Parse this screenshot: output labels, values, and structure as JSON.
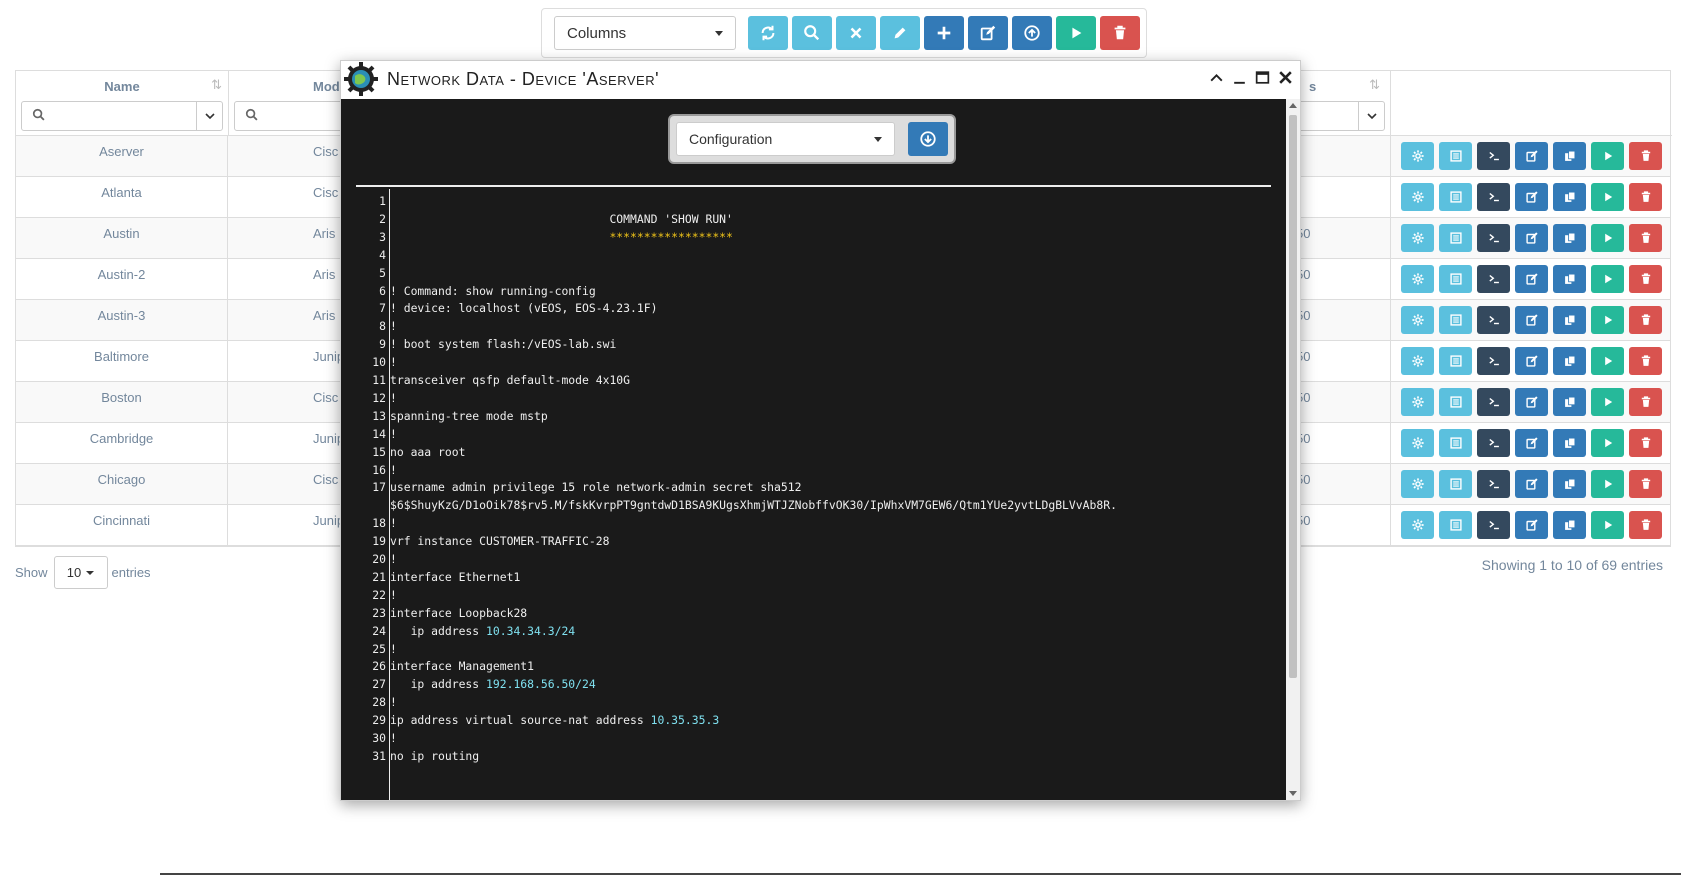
{
  "toolbar": {
    "columns_select": "Columns",
    "buttons": [
      {
        "icon": "refresh-icon",
        "color": "#5bc0de"
      },
      {
        "icon": "search-icon",
        "color": "#5bc0de"
      },
      {
        "icon": "clear-icon",
        "color": "#5bc0de"
      },
      {
        "icon": "pencil-icon",
        "color": "#5bc0de"
      },
      {
        "icon": "plus-icon",
        "color": "#337ab7"
      },
      {
        "icon": "edit-icon",
        "color": "#337ab7"
      },
      {
        "icon": "upload-icon",
        "color": "#337ab7"
      },
      {
        "icon": "play-icon",
        "color": "#26b99a"
      },
      {
        "icon": "trash-icon",
        "color": "#d9534f"
      }
    ]
  },
  "table": {
    "columns": {
      "name": "Name",
      "model_partial": "Mod",
      "right_partial": "s"
    },
    "rows": [
      {
        "name": "Aserver",
        "model": "Cisc",
        "right": ""
      },
      {
        "name": "Atlanta",
        "model": "Cisc",
        "right": ""
      },
      {
        "name": "Austin",
        "model": "Aris",
        "right": "50"
      },
      {
        "name": "Austin-2",
        "model": "Aris",
        "right": "50"
      },
      {
        "name": "Austin-3",
        "model": "Aris",
        "right": "50"
      },
      {
        "name": "Baltimore",
        "model": "Junip",
        "right": "50"
      },
      {
        "name": "Boston",
        "model": "Cisc",
        "right": "50"
      },
      {
        "name": "Cambridge",
        "model": "Junip",
        "right": "50"
      },
      {
        "name": "Chicago",
        "model": "Cisc",
        "right": "50"
      },
      {
        "name": "Cincinnati",
        "model": "Junip",
        "right": "50"
      }
    ]
  },
  "footer": {
    "show_label": "Show",
    "page_length": "10",
    "entries_label": "entries",
    "info": "Showing 1 to 10 of 69 entries"
  },
  "modal": {
    "title": "Network Data - Device 'Aserver'",
    "select_value": "Configuration",
    "code_lines": [
      {
        "n": "1",
        "t": ""
      },
      {
        "n": "2",
        "t": "                                COMMAND 'SHOW RUN'"
      },
      {
        "n": "3",
        "t": "                                ******************",
        "cls": "stars"
      },
      {
        "n": "4",
        "t": ""
      },
      {
        "n": "5",
        "t": ""
      },
      {
        "n": "6",
        "t": "! Command: show running-config"
      },
      {
        "n": "7",
        "t": "! device: localhost (vEOS, EOS-4.23.1F)"
      },
      {
        "n": "8",
        "t": "!"
      },
      {
        "n": "9",
        "t": "! boot system flash:/vEOS-lab.swi"
      },
      {
        "n": "10",
        "t": "!"
      },
      {
        "n": "11",
        "t": "transceiver qsfp default-mode 4x10G"
      },
      {
        "n": "12",
        "t": "!"
      },
      {
        "n": "13",
        "t": "spanning-tree mode mstp"
      },
      {
        "n": "14",
        "t": "!"
      },
      {
        "n": "15",
        "t": "no aaa root"
      },
      {
        "n": "16",
        "t": "!"
      },
      {
        "n": "17",
        "t": "username admin privilege 15 role network-admin secret sha512"
      },
      {
        "n": "",
        "t": "$6$ShuyKzG/D1oOik78$rv5.M/fskKvrpPT9gntdwD1BSA9KUgsXhmjWTJZNobffvOK30/IpWhxVM7GEW6/Qtm1YUe2yvtLDgBLVvAb8R."
      },
      {
        "n": "18",
        "t": "!"
      },
      {
        "n": "19",
        "t": "vrf instance CUSTOMER-TRAFFIC-28"
      },
      {
        "n": "20",
        "t": "!"
      },
      {
        "n": "21",
        "t": "interface Ethernet1"
      },
      {
        "n": "22",
        "t": "!"
      },
      {
        "n": "23",
        "t": "interface Loopback28"
      },
      {
        "n": "24",
        "t": "   ip address ",
        "hl": "10.34.34.3/24"
      },
      {
        "n": "25",
        "t": "!"
      },
      {
        "n": "26",
        "t": "interface Management1"
      },
      {
        "n": "27",
        "t": "   ip address ",
        "hl": "192.168.56.50/24"
      },
      {
        "n": "28",
        "t": "!"
      },
      {
        "n": "29",
        "t": "ip address virtual source-nat address ",
        "hl": "10.35.35.3"
      },
      {
        "n": "30",
        "t": "!"
      },
      {
        "n": "31",
        "t": "no ip routing"
      }
    ]
  },
  "colors": {
    "info": "#5bc0de",
    "primary": "#337ab7",
    "success": "#26b99a",
    "danger": "#d9534f",
    "dark": "#34495e",
    "terminal_bg": "#1a1a1a"
  }
}
